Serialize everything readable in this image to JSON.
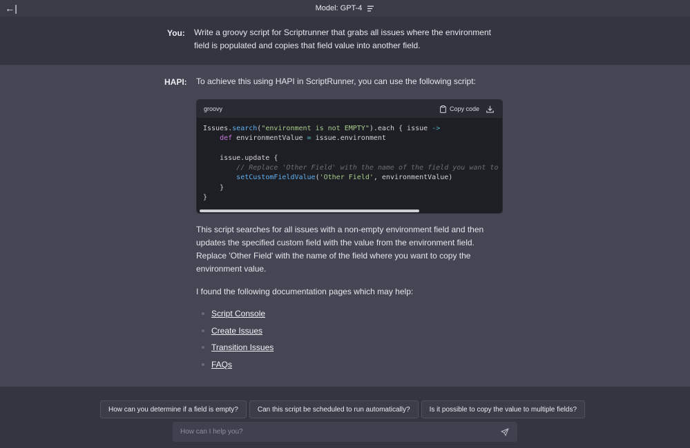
{
  "header": {
    "back_icon": "←|",
    "model_label": "Model: GPT-4"
  },
  "user_message": {
    "speaker": "You:",
    "text": "Write a groovy script for Scriptrunner that grabs all issues where the environment field is populated and copies that field value into another field."
  },
  "assistant_message": {
    "speaker": "HAPI:",
    "intro": "To achieve this using HAPI in ScriptRunner, you can use the following script:",
    "code": {
      "language": "groovy",
      "copy_label": "Copy code",
      "lines": [
        "Issues.search(\"environment is not EMPTY\").each { issue ->",
        "    def environmentValue = issue.environment",
        "",
        "    issue.update {",
        "        // Replace 'Other Field' with the name of the field you want to copy",
        "        setCustomFieldValue('Other Field', environmentValue)",
        "    }",
        "}"
      ]
    },
    "explanation": "This script searches for all issues with a non-empty environment field and then updates the specified custom field with the value from the environment field. Replace 'Other Field' with the name of the field where you want to copy the environment value.",
    "docs_intro": "I found the following documentation pages which may help:",
    "doc_links": [
      "Script Console",
      "Create Issues",
      "Transition Issues",
      "FAQs"
    ]
  },
  "suggestions": [
    "How can you determine if a field is empty?",
    "Can this script be scheduled to run automatically?",
    "Is it possible to copy the value to multiple fields?"
  ],
  "input": {
    "placeholder": "How can I help you?",
    "value": ""
  },
  "icons": {
    "back": "back-arrow-icon",
    "menu": "menu-icon",
    "clipboard": "clipboard-icon",
    "download": "download-icon",
    "send": "send-icon"
  }
}
